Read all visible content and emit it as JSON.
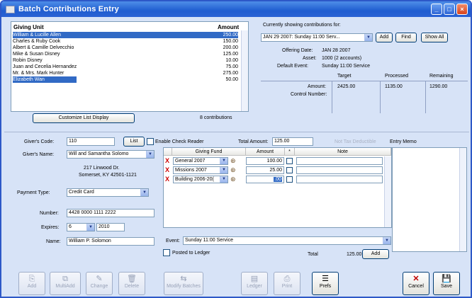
{
  "window": {
    "title": "Batch Contributions Entry"
  },
  "giving_list": {
    "header_unit": "Giving Unit",
    "header_amount": "Amount",
    "rows": [
      {
        "name": "William & Lucille Allen",
        "amount": "250.00"
      },
      {
        "name": "Charles & Ruby Cook",
        "amount": "150.00"
      },
      {
        "name": "Albert & Camille Delvecchio",
        "amount": "200.00"
      },
      {
        "name": "Mike & Susan Disney",
        "amount": "125.00"
      },
      {
        "name": "Robin Disney",
        "amount": "10.00"
      },
      {
        "name": "Juan and Cecelia Hernandez",
        "amount": "75.00"
      },
      {
        "name": "Mr. & Mrs. Mark Hunter",
        "amount": "275.00"
      },
      {
        "name": "Elizabeth Wan",
        "amount": "50.00"
      }
    ],
    "customize_label": "Customize List Display",
    "count_text": "8 contributions"
  },
  "summary": {
    "showing_label": "Currently showing contributions for:",
    "showing_value": "JAN 29 2007: Sunday 11:00 Serv...",
    "add_label": "Add",
    "find_label": "Find",
    "show_all_label": "Show All",
    "offering_date_label": "Offering Date:",
    "offering_date_value": "JAN 28 2007",
    "asset_label": "Asset:",
    "asset_value": "1000 (2 accounts)",
    "default_event_label": "Default Event:",
    "default_event_value": "Sunday 11:00 Service",
    "col_target": "Target",
    "col_processed": "Processed",
    "col_remaining": "Remaining",
    "amount_label": "Amount:",
    "target": "2425.00",
    "processed": "1135.00",
    "remaining": "1290.00",
    "control_label": "Control Number:"
  },
  "form": {
    "givers_code_label": "Giver's Code:",
    "givers_code_value": "110",
    "list_label": "List",
    "check_reader_label": "Enable Check Reader",
    "total_amount_label": "Total Amount:",
    "total_amount_value": "125.00",
    "not_tax_label": "Not Tax Deductible",
    "entry_memo_label": "Entry Memo",
    "givers_name_label": "Giver's Name:",
    "givers_name_value": "Will and Samantha Solomo",
    "address1": "217 Linwood Dr.",
    "address2": "Somerset, KY 42501-1121",
    "payment_type_label": "Payment Type:",
    "payment_type_value": "Credit Card",
    "number_label": "Number:",
    "number_value": "4428 0000 1111 2222",
    "expires_label": "Expires:",
    "expires_month": "6",
    "expires_year": "2010",
    "name_label": "Name:",
    "name_value": "William P. Solomon"
  },
  "fund_grid": {
    "col_fund": "Giving Fund",
    "col_amount": "Amount",
    "col_star": "*",
    "col_note": "Note",
    "rows": [
      {
        "fund": "General 2007",
        "amount": "100.00"
      },
      {
        "fund": "Missions 2007",
        "amount": "25.00"
      },
      {
        "fund": "Building 2006-20(",
        "amount": ".00"
      }
    ],
    "event_label": "Event:",
    "event_value": "Sunday 11:00 Service",
    "posted_label": "Posted to Ledger",
    "total_label": "Total",
    "total_value": "125.00",
    "add_label": "Add"
  },
  "toolbar": {
    "add": "Add",
    "multiadd": "MultiAdd",
    "change": "Change",
    "delete": "Delete",
    "modify_batches": "Modify Batches",
    "ledger": "Ledger",
    "print": "Print",
    "prefs": "Prefs",
    "cancel": "Cancel",
    "save": "Save"
  },
  "colors": {
    "title_bar": "#2a62d4",
    "selection": "#316ac5",
    "cancel_icon": "#c00000"
  }
}
